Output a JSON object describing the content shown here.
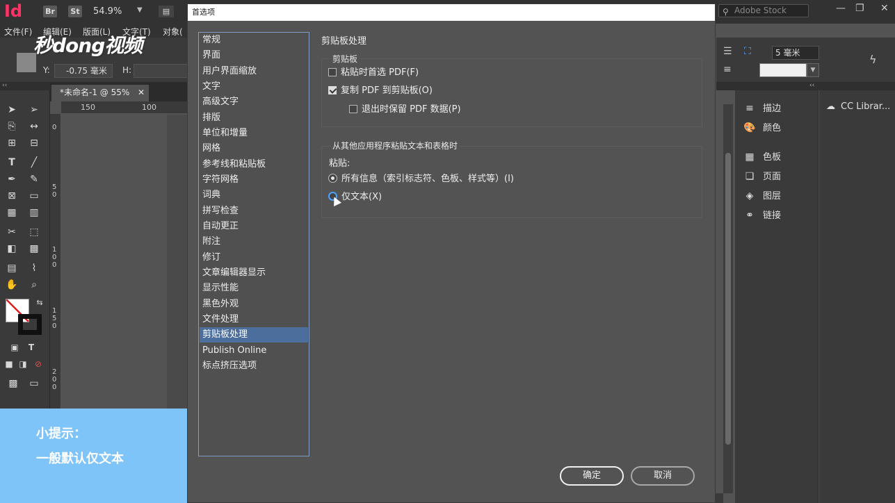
{
  "app": {
    "logo": "Id",
    "chips": [
      "Br",
      "St"
    ],
    "zoom": "54.9%",
    "search_placeholder": "Adobe Stock",
    "menu": [
      "文件(F)",
      "编辑(E)",
      "版面(L)",
      "文字(T)",
      "对象("
    ],
    "control": {
      "y_label": "Y:",
      "y_value": "-0.75 毫米",
      "h_label": "H:",
      "stroke_weight": "5 毫米"
    },
    "doc_tab": "*未命名-1 @ 55%",
    "ruler_h": [
      "150",
      "100"
    ],
    "ruler_v": [
      "0",
      "50",
      "100",
      "150",
      "200"
    ]
  },
  "right_panels": {
    "items": [
      "描边",
      "颜色",
      "色板",
      "页面",
      "图层",
      "链接"
    ],
    "cc": "CC Librar..."
  },
  "watermark": "秒dong视频",
  "tip": {
    "line1": "小提示：",
    "line2": "一般默认仅文本"
  },
  "dialog": {
    "title": "首选项",
    "categories": [
      "常规",
      "界面",
      "用户界面缩放",
      "文字",
      "高级文字",
      "排版",
      "单位和增量",
      "网格",
      "参考线和粘贴板",
      "字符网格",
      "词典",
      "拼写检查",
      "自动更正",
      "附注",
      "修订",
      "文章编辑器显示",
      "显示性能",
      "黑色外观",
      "文件处理",
      "剪贴板处理",
      "Publish Online",
      "标点挤压选项"
    ],
    "selected_category": "剪贴板处理",
    "section_title": "剪贴板处理",
    "clipboard_group": {
      "title": "剪贴板",
      "prefer_pdf": "粘贴时首选 PDF(F)",
      "copy_pdf": "复制 PDF 到剪贴板(O)",
      "retain_pdf": "退出时保留 PDF 数据(P)"
    },
    "paste_group": {
      "title": "从其他应用程序粘贴文本和表格时",
      "label": "粘贴:",
      "all_info": "所有信息（索引标志符、色板、样式等）(I)",
      "text_only": "仅文本(X)"
    },
    "ok": "确定",
    "cancel": "取消"
  }
}
